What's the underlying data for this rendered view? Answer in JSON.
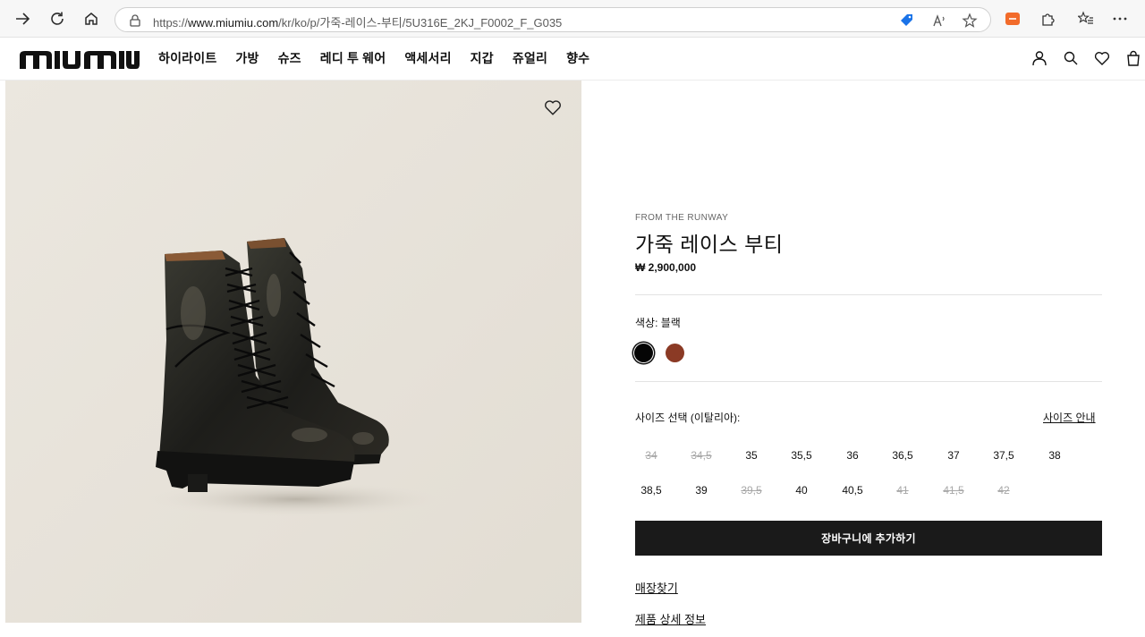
{
  "browser": {
    "url_prefix": "https://",
    "url_domain": "www.miumiu.com",
    "url_path": "/kr/ko/p/가죽-레이스-부티/5U316E_2KJ_F0002_F_G035"
  },
  "header": {
    "logo": "miu miu",
    "nav": [
      "하이라이트",
      "가방",
      "슈즈",
      "레디 투 웨어",
      "액세서리",
      "지갑",
      "쥬얼리",
      "향수"
    ]
  },
  "product": {
    "eyebrow": "FROM THE RUNWAY",
    "title": "가죽 레이스 부티",
    "price": "₩ 2,900,000",
    "color_label": "색상:  블랙",
    "colors": [
      "#050505",
      "#8b3a25"
    ],
    "size_label": "사이즈 선택 (이탈리아):",
    "size_guide": "사이즈 안내",
    "sizes": [
      {
        "label": "34",
        "available": false
      },
      {
        "label": "34,5",
        "available": false
      },
      {
        "label": "35",
        "available": true
      },
      {
        "label": "35,5",
        "available": true
      },
      {
        "label": "36",
        "available": true
      },
      {
        "label": "36,5",
        "available": true
      },
      {
        "label": "37",
        "available": true
      },
      {
        "label": "37,5",
        "available": true
      },
      {
        "label": "38",
        "available": true
      },
      {
        "label": "38,5",
        "available": true
      },
      {
        "label": "39",
        "available": true
      },
      {
        "label": "39,5",
        "available": false
      },
      {
        "label": "40",
        "available": true
      },
      {
        "label": "40,5",
        "available": true
      },
      {
        "label": "41",
        "available": false
      },
      {
        "label": "41,5",
        "available": false
      },
      {
        "label": "42",
        "available": false
      }
    ],
    "add_to_cart": "장바구니에 추가하기",
    "store_locator": "매장찾기",
    "details": "제품 상세 정보"
  }
}
